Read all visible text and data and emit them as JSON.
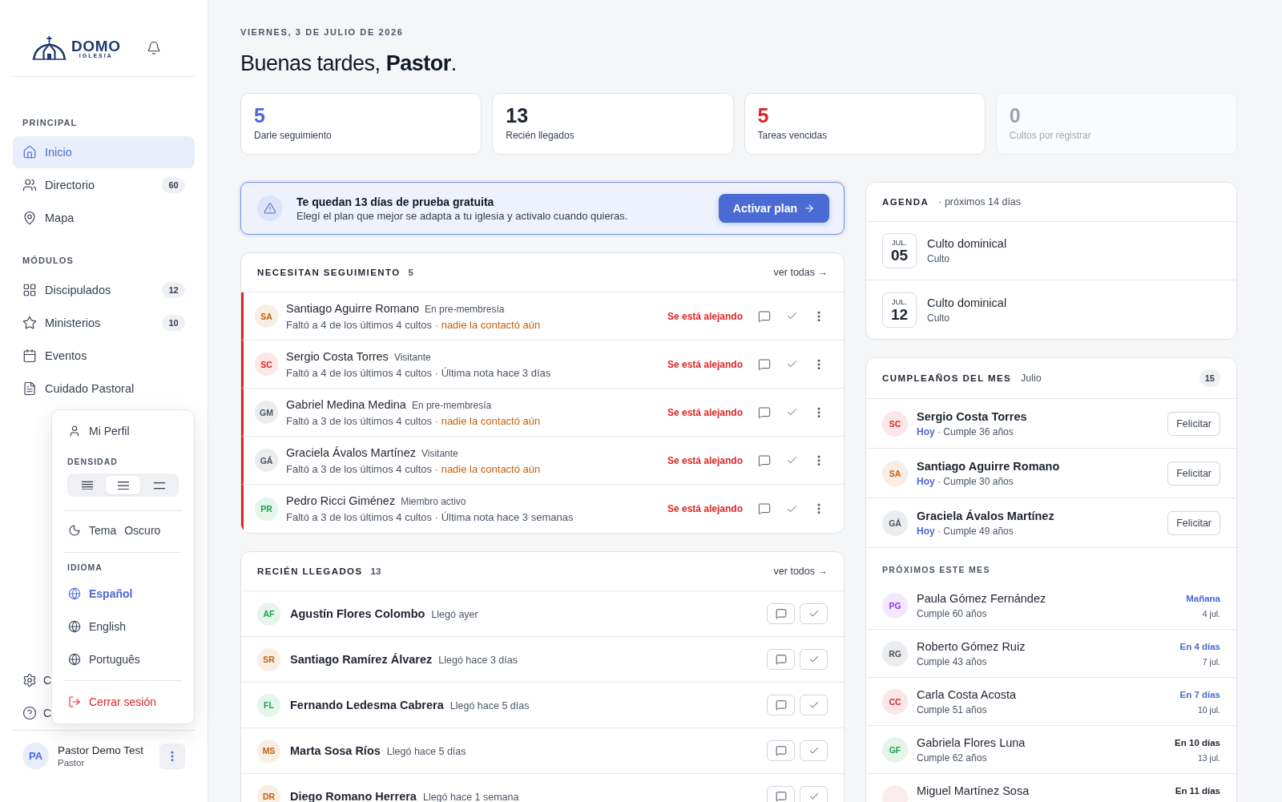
{
  "sidebar": {
    "logo": {
      "name": "DOMO",
      "tagline": "IGLESIA"
    },
    "sections": [
      {
        "title": "PRINCIPAL",
        "items": [
          {
            "label": "Inicio",
            "selected": true
          },
          {
            "label": "Directorio",
            "count": "60",
            "selected": false
          },
          {
            "label": "Mapa",
            "selected": false
          }
        ]
      },
      {
        "title": "MÓDULOS",
        "items": [
          {
            "label": "Discipulados",
            "count": "12",
            "selected": false
          },
          {
            "label": "Ministerios",
            "count": "10",
            "selected": false
          },
          {
            "label": "Eventos",
            "selected": false
          },
          {
            "label": "Cuidado Pastoral",
            "selected": false
          }
        ]
      }
    ],
    "footer_items": [
      {
        "label": "C",
        "selected": false
      },
      {
        "label": "C",
        "selected": false
      }
    ],
    "user": {
      "initials": "PA",
      "name": "Pastor Demo Test",
      "role": "Pastor"
    }
  },
  "user_menu": {
    "profile": "Mi Perfil",
    "density": {
      "title": "DENSIDAD",
      "options": [
        {
          "kind": "compact",
          "selected": false
        },
        {
          "kind": "normal",
          "selected": true
        },
        {
          "kind": "comfortable",
          "selected": false
        }
      ]
    },
    "theme": {
      "label": "Tema",
      "value": "Oscuro"
    },
    "language": {
      "title": "IDIOMA",
      "options": [
        {
          "label": "Español",
          "selected": true
        },
        {
          "label": "English",
          "selected": false
        },
        {
          "label": "Português",
          "selected": false
        }
      ]
    },
    "logout": "Cerrar sesión"
  },
  "header": {
    "date": "VIERNES, 3 DE JULIO DE 2026",
    "greeting": "Buenas tardes, **Pastor**."
  },
  "stats": [
    {
      "value": "5",
      "label": "Darle seguimiento",
      "color": "#4a6ad4",
      "dimmed": false
    },
    {
      "value": "13",
      "label": "Recién llegados",
      "color": "#1f2430",
      "dimmed": false
    },
    {
      "value": "5",
      "label": "Tareas vencidas",
      "color": "#dc2626",
      "dimmed": false
    },
    {
      "value": "0",
      "label": "Cultos por registrar",
      "color": "#9ca3af",
      "dimmed": true
    }
  ],
  "trial_banner": {
    "title": "Te quedan 13 días de prueba gratuita",
    "message": "Elegí el plan que mejor se adapta a tu iglesia y activalo cuando quieras.",
    "button": "Activar plan"
  },
  "follow_up": {
    "title": "NECESITAN SEGUIMIENTO",
    "count": "5",
    "link": "ver todas →",
    "rows": [
      {
        "initials": "SA",
        "color": "#c2610c",
        "name": "Santiago Aguirre Romano",
        "role": "En pre-membresía",
        "detail": "Faltó a 4 de los últimos 4 cultos",
        "note": "· nadie la contactó aún",
        "uncontacted": true,
        "status": "Se está alejando",
        "alert": true
      },
      {
        "initials": "SC",
        "color": "#dc2626",
        "name": "Sergio Costa Torres",
        "role": "Visitante",
        "detail": "Faltó a 4 de los últimos 4 cultos",
        "note": "· Última nota hace 3 días",
        "uncontacted": false,
        "status": "Se está alejando",
        "alert": true
      },
      {
        "initials": "GM",
        "color": "#4b5563",
        "name": "Gabriel Medina Medina",
        "role": "En pre-membresía",
        "detail": "Faltó a 3 de los últimos 4 cultos",
        "note": "· nadie la contactó aún",
        "uncontacted": true,
        "status": "Se está alejando",
        "alert": true
      },
      {
        "initials": "GÁ",
        "color": "#4b5563",
        "name": "Graciela Ávalos Martínez",
        "role": "Visitante",
        "detail": "Faltó a 3 de los últimos 4 cultos",
        "note": "· nadie la contactó aún",
        "uncontacted": true,
        "status": "Se está alejando",
        "alert": true
      },
      {
        "initials": "PR",
        "color": "#16a34a",
        "name": "Pedro Ricci Giménez",
        "role": "Miembro activo",
        "detail": "Faltó a 3 de los últimos 4 cultos",
        "note": "· Última nota hace 3 semanas",
        "uncontacted": false,
        "status": "Se está alejando",
        "alert": true
      }
    ]
  },
  "newcomers": {
    "title": "RECIÉN LLEGADOS",
    "count": "13",
    "link": "ver todos →",
    "rows": [
      {
        "initials": "AF",
        "color": "#16a34a",
        "name": "Agustín Flores Colombo",
        "arrived": "Llegó ayer"
      },
      {
        "initials": "SR",
        "color": "#c2610c",
        "name": "Santiago Ramírez Álvarez",
        "arrived": "Llegó hace 3 días"
      },
      {
        "initials": "FL",
        "color": "#16a34a",
        "name": "Fernando Ledesma Cabrera",
        "arrived": "Llegó hace 5 días"
      },
      {
        "initials": "MS",
        "color": "#c2610c",
        "name": "Marta Sosa Ríos",
        "arrived": "Llegó hace 5 días"
      },
      {
        "initials": "DR",
        "color": "#c2610c",
        "name": "Diego Romano Herrera",
        "arrived": "Llegó hace 1 semana"
      }
    ]
  },
  "agenda": {
    "title": "AGENDA",
    "subtitle": "· próximos 14 días",
    "events": [
      {
        "month": "JUL.",
        "day": "05",
        "title": "Culto dominical",
        "type": "Culto"
      },
      {
        "month": "JUL.",
        "day": "12",
        "title": "Culto dominical",
        "type": "Culto"
      }
    ]
  },
  "birthdays": {
    "title": "CUMPLEAÑOS DEL MES",
    "month": "Julio",
    "count": "15",
    "today": [
      {
        "initials": "SC",
        "color": "#dc2626",
        "name": "Sergio Costa Torres",
        "when": "Hoy",
        "age": "· Cumple 36 años",
        "button": "Felicitar"
      },
      {
        "initials": "SA",
        "color": "#c2610c",
        "name": "Santiago Aguirre Romano",
        "when": "Hoy",
        "age": "· Cumple 30 años",
        "button": "Felicitar"
      },
      {
        "initials": "GÁ",
        "color": "#4b5563",
        "name": "Graciela Ávalos Martínez",
        "when": "Hoy",
        "age": "· Cumple 49 años",
        "button": "Felicitar"
      }
    ],
    "upcoming_title": "PRÓXIMOS ESTE MES",
    "upcoming": [
      {
        "initials": "PG",
        "color": "#9333ea",
        "name": "Paula Gómez Fernández",
        "age": "Cumple 60 años",
        "when": "Mañana",
        "date": "4 jul.",
        "soon": true
      },
      {
        "initials": "RG",
        "color": "#4b5563",
        "name": "Roberto Gómez Ruiz",
        "age": "Cumple 43 años",
        "when": "En 4 días",
        "date": "7 jul.",
        "soon": true
      },
      {
        "initials": "CC",
        "color": "#dc2626",
        "name": "Carla Costa Acosta",
        "age": "Cumple 51 años",
        "when": "En 7 días",
        "date": "10 jul.",
        "soon": true
      },
      {
        "initials": "GF",
        "color": "#16a34a",
        "name": "Gabriela Flores Luna",
        "age": "Cumple 62 años",
        "when": "En 10 días",
        "date": "13 jul.",
        "soon": false
      },
      {
        "name": "Miguel Martínez Sosa",
        "when": "En 11 días",
        "soon": false
      }
    ]
  }
}
